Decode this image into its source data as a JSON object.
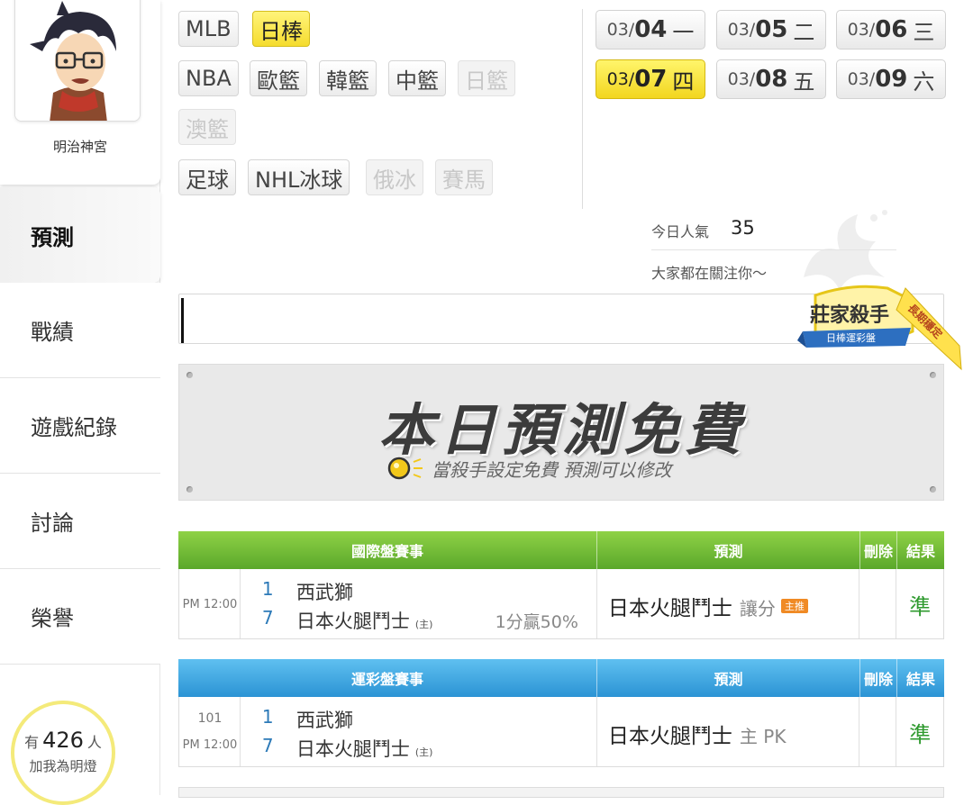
{
  "profile": {
    "username": "明治神宮",
    "avatar_icon": "anime-boy-avatar"
  },
  "nav": [
    {
      "label": "預測",
      "active": true
    },
    {
      "label": "戰績",
      "active": false
    },
    {
      "label": "遊戲紀錄",
      "active": false
    },
    {
      "label": "討論",
      "active": false
    },
    {
      "label": "榮譽",
      "active": false
    }
  ],
  "fans": {
    "prefix": "有",
    "count": "426",
    "suffix": "人",
    "line2": "加我為明燈"
  },
  "sports": {
    "mlb": "MLB",
    "jpn_baseball": "日棒",
    "nba": "NBA",
    "euro_bball": "歐籃",
    "kor_bball": "韓籃",
    "chn_bball": "中籃",
    "jpn_bball": "日籃",
    "aus_bball": "澳籃",
    "soccer": "足球",
    "nhl": "NHL冰球",
    "rus_hockey": "俄冰",
    "horse": "賽馬"
  },
  "dates": [
    {
      "month": "03/",
      "day": "04",
      "weekday": "一",
      "active": false
    },
    {
      "month": "03/",
      "day": "05",
      "weekday": "二",
      "active": false
    },
    {
      "month": "03/",
      "day": "06",
      "weekday": "三",
      "active": false
    },
    {
      "month": "03/",
      "day": "07",
      "weekday": "四",
      "active": true
    },
    {
      "month": "03/",
      "day": "08",
      "weekday": "五",
      "active": false
    },
    {
      "month": "03/",
      "day": "09",
      "weekday": "六",
      "active": false
    }
  ],
  "popularity": {
    "label": "今日人氣",
    "value": "35",
    "subtitle": "大家都在關注你～"
  },
  "badge": {
    "title": "莊家殺手",
    "ribbon": "日棒運彩盤",
    "corner": "長期穩定"
  },
  "free_panel": {
    "title": "本日預測免費",
    "subtitle": "當殺手設定免費  預測可以修改",
    "icon": "lightbulb-icon"
  },
  "intl_table": {
    "headers": {
      "event": "國際盤賽事",
      "pred": "預測",
      "del": "刪除",
      "result": "結果"
    },
    "row": {
      "time": "PM 12:00",
      "away_score": "1",
      "away_team": "西武獅",
      "home_score": "7",
      "home_team": "日本火腿鬥士",
      "home_mark": "(主)",
      "handicap": "1分贏50%",
      "pred_team": "日本火腿鬥士",
      "pred_type": "讓分",
      "pred_tag": "主推",
      "result": "準"
    }
  },
  "sports_lottery_table": {
    "headers": {
      "event": "運彩盤賽事",
      "pred": "預測",
      "del": "刪除",
      "result": "結果"
    },
    "row": {
      "game_no": "101",
      "time": "PM 12:00",
      "away_score": "1",
      "away_team": "西武獅",
      "home_score": "7",
      "home_team": "日本火腿鬥士",
      "home_mark": "(主)",
      "pred_team": "日本火腿鬥士",
      "pred_type": "主 PK",
      "result": "準"
    }
  },
  "colors": {
    "accent_yellow": "#f5dc2e",
    "green_header": "#6bb630",
    "blue_header": "#3aa0dd",
    "result_green": "#2f9a2f"
  }
}
